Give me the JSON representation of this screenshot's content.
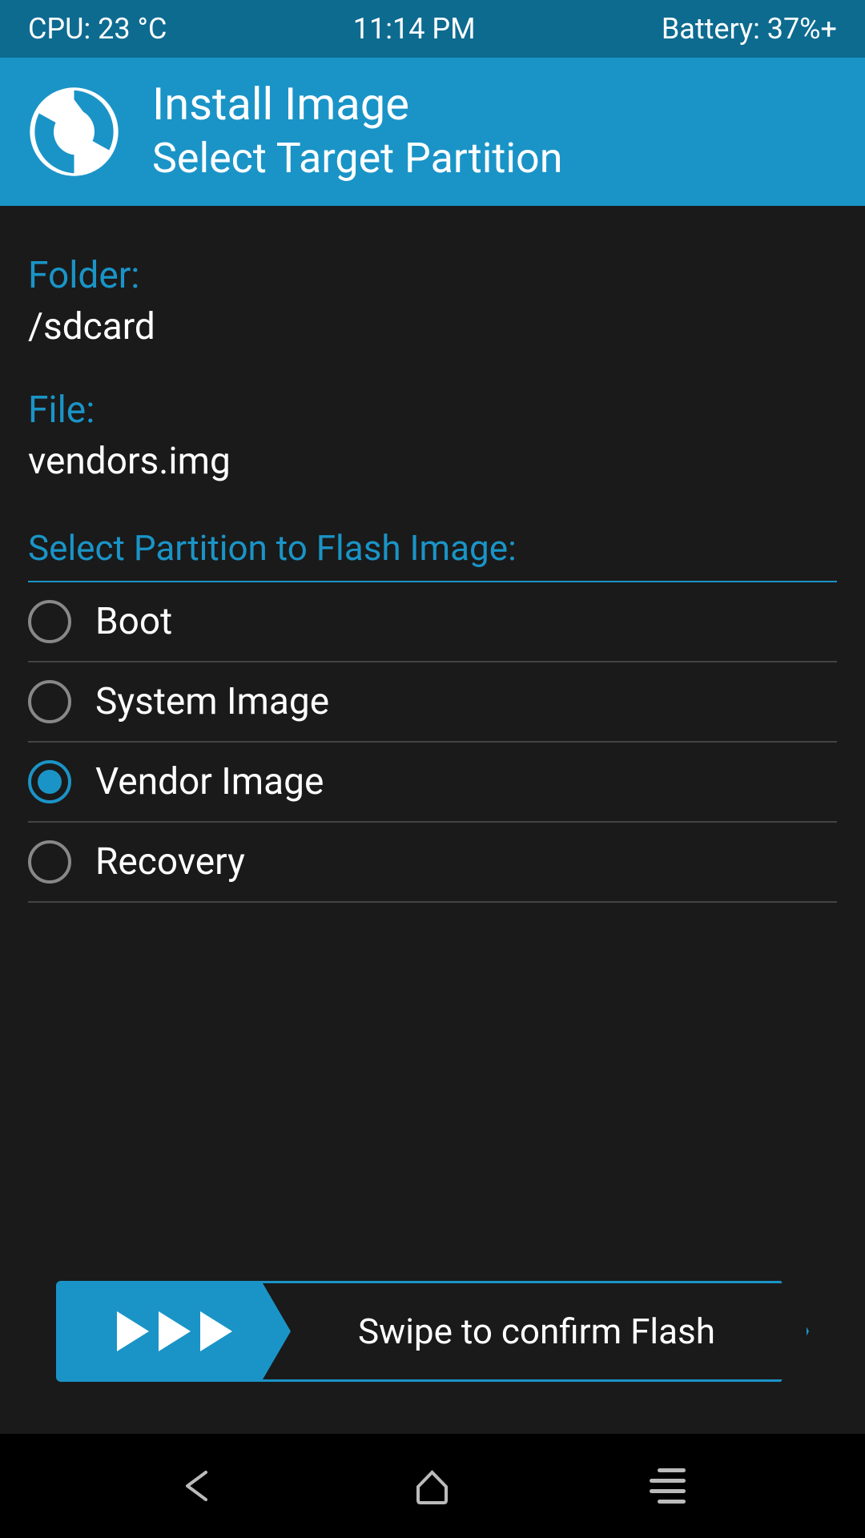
{
  "status_bar": {
    "cpu": "CPU: 23 °C",
    "time": "11:14 PM",
    "battery": "Battery: 37%+"
  },
  "header": {
    "title": "Install Image",
    "subtitle": "Select Target Partition"
  },
  "folder": {
    "label": "Folder:",
    "value": "/sdcard"
  },
  "file": {
    "label": "File:",
    "value": "vendors.img"
  },
  "partition_section": {
    "title": "Select Partition to Flash Image:"
  },
  "partitions": [
    {
      "label": "Boot",
      "selected": false
    },
    {
      "label": "System Image",
      "selected": false
    },
    {
      "label": "Vendor Image",
      "selected": true
    },
    {
      "label": "Recovery",
      "selected": false
    }
  ],
  "swipe": {
    "text": "Swipe to confirm Flash"
  }
}
